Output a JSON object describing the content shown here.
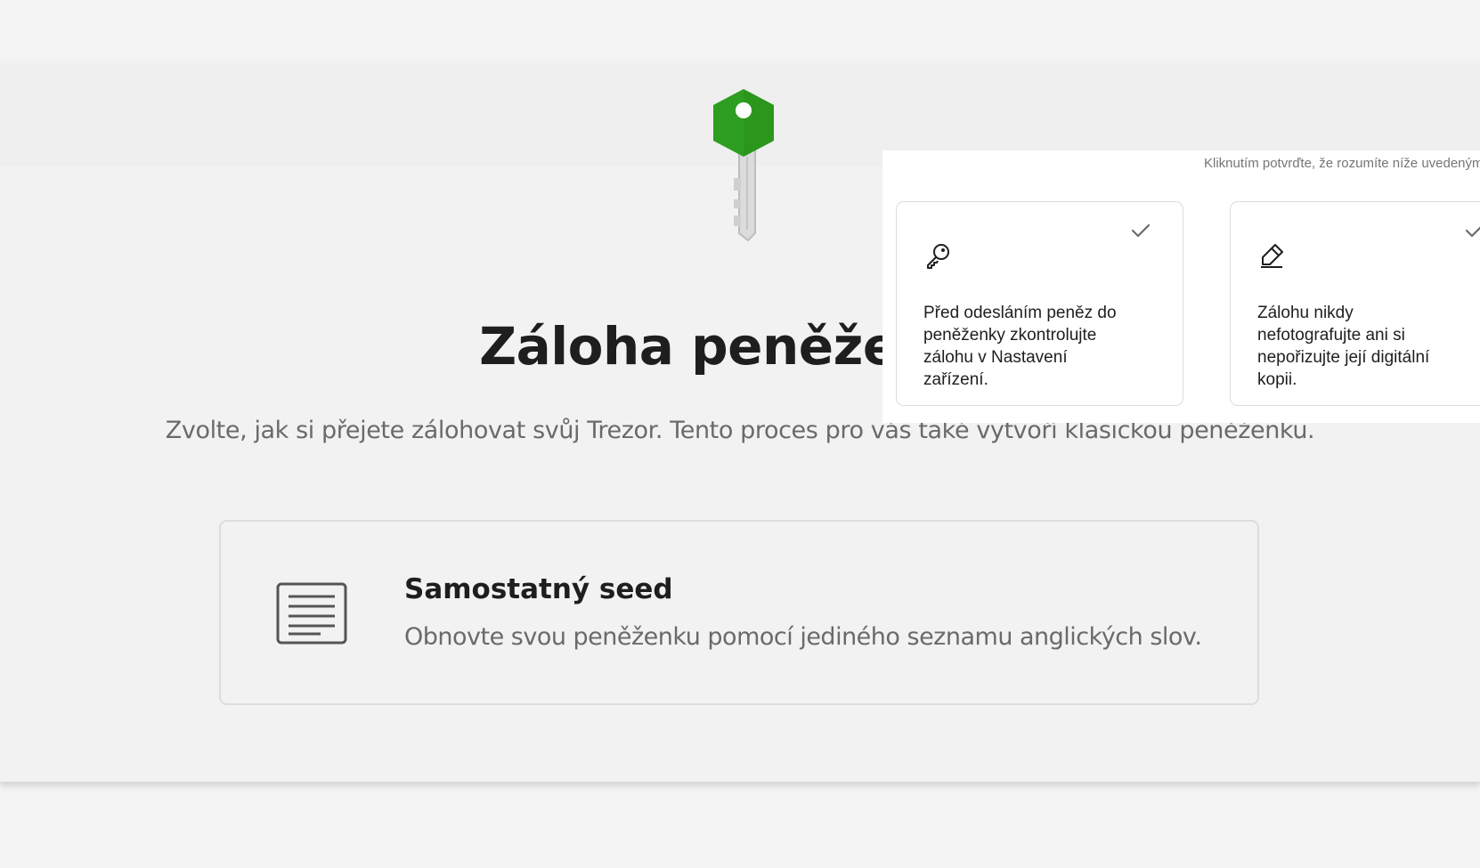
{
  "backup": {
    "title": "Záloha peněženky",
    "subtitle": "Zvolte, jak si přejete zálohovat svůj Trezor. Tento proces pro vás také vytvoří klasickou peněženku.",
    "key_icon": "green-key-illustration",
    "option": {
      "icon": "document-lines-icon",
      "title": "Samostatný seed",
      "description": "Obnovte svou peněženku pomocí jediného seznamu anglických slov."
    }
  },
  "confirm_panel": {
    "note": "Kliknutím potvrďte, že rozumíte níže uvedeným",
    "tiles": [
      {
        "icon": "key-icon",
        "checked": true,
        "text": "Před odesláním peněz do peněženky zkontrolujte zálohu v Nastavení zařízení."
      },
      {
        "icon": "pencil-icon",
        "checked": true,
        "text": "Zálohu nikdy nefotografujte ani si nepořizujte její digitální kopii."
      }
    ]
  },
  "colors": {
    "key_green": "#2d9e1f",
    "text_dark": "#1e1e1e",
    "text_muted": "#6a6a6a",
    "background": "#f3f3f3"
  }
}
